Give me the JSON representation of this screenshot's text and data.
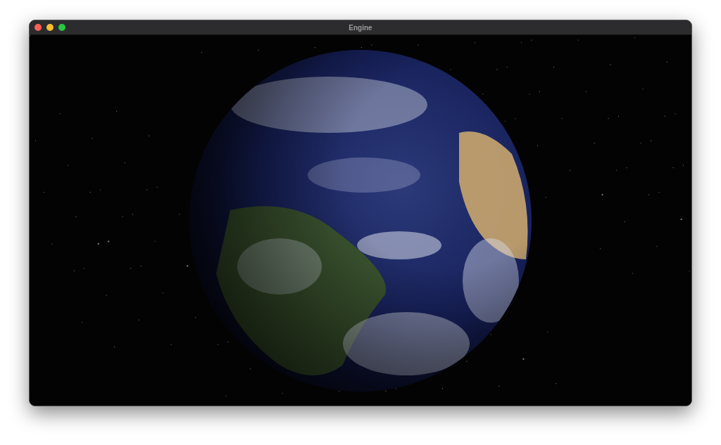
{
  "window": {
    "title": "Engine",
    "controls": [
      {
        "kind": "close"
      },
      {
        "kind": "minimize"
      },
      {
        "kind": "zoom"
      }
    ]
  }
}
